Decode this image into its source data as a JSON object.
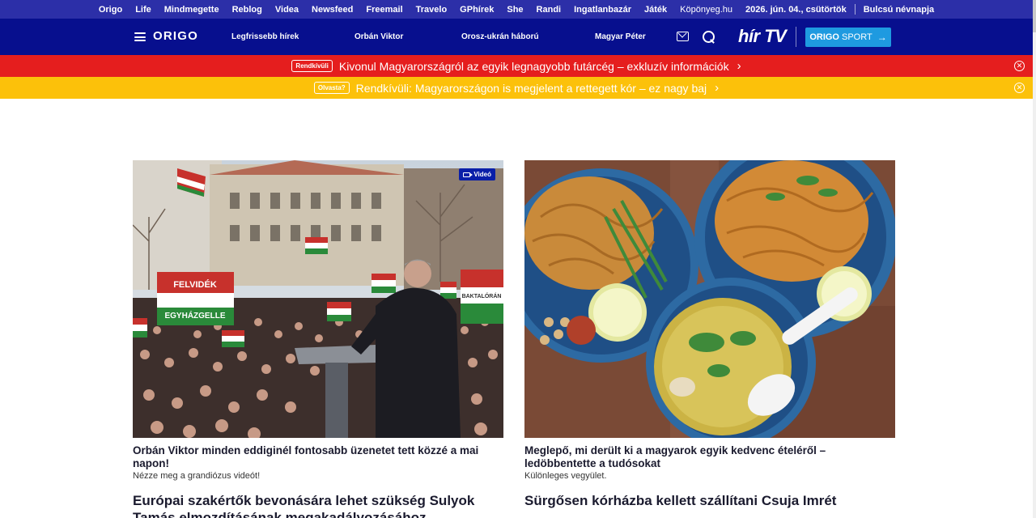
{
  "topbar": {
    "links": [
      "Origo",
      "Life",
      "Mindmegette",
      "Reblog",
      "Videa",
      "Newsfeed",
      "Freemail",
      "Travelo",
      "GPhírek",
      "She",
      "Randi",
      "Ingatlanbazár",
      "Játék",
      "Köpönyeg.hu"
    ],
    "date": "2026. jún. 04., csütörtök",
    "nameday": "Bulcsú névnapja",
    "color": "#2c2fa8"
  },
  "header": {
    "logo": "ORIGO",
    "nav": [
      "Legfrissebb hírek",
      "Orbán Viktor",
      "Orosz-ukrán háború",
      "Magyar Péter"
    ],
    "hirtv_logo": "hír TV",
    "sport_brand": "ORIGO",
    "sport_label": "SPORT",
    "color": "#070f8e",
    "sport_color": "#1e9ae0"
  },
  "alerts": [
    {
      "badge": "Rendkívüli",
      "text": "Kivonul Magyarországról az egyik legnagyobb futárcég – exkluzív információk",
      "color": "#e51e1e"
    },
    {
      "badge": "Olvasta?",
      "text": "Rendkívüli: Magyarországon is megjelent a rettegett kór – ez nagy baj",
      "color": "#fcc10a"
    }
  ],
  "articles": [
    {
      "title": "Orbán Viktor minden eddiginél fontosabb üzenetet tett közzé a mai napon!",
      "lead": "Nézze meg a grandiózus videót!",
      "badge": "Videó",
      "image_signs": {
        "flag1": "FELVIDÉK",
        "flag2": "EGYHÁZGELLE",
        "flag3": "BAKTALÓRÁN"
      }
    },
    {
      "title": "Meglepő, mi derült ki a magyarok egyik kedvenc ételéről – ledöbbentette a tudósokat",
      "lead": "Különleges vegyület."
    }
  ],
  "next_articles": [
    "Európai szakértők bevonására lehet szükség Sulyok Tamás elmozdításának megakadályozásához",
    "Sürgősen kórházba kellett szállítani Csuja Imrét"
  ]
}
